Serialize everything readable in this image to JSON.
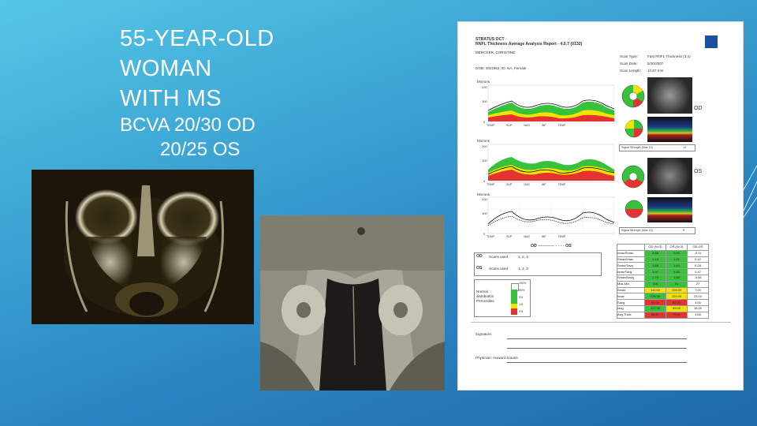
{
  "slide": {
    "title_lines": [
      "55-YEAR-OLD",
      "WOMAN",
      "WITH MS"
    ],
    "bcva_od": "BCVA 20/30 OD",
    "bcva_os": "20/25 OS"
  },
  "report": {
    "header_line1": "STRATUS OCT",
    "header_line2": "RNFL Thickness Average Analysis  Report - 4.0.7 (0132)",
    "patient_name": "MERCKER, CHRISTINE",
    "dob": "DOB: 4/5/1952, ID: NA, Female",
    "scan_type_label": "Scan Type:",
    "scan_type_value": "Fast RNFL Thickness (3.4)",
    "scan_date_label": "Scan Date:",
    "scan_date_value": "5/30/2007",
    "scan_length_label": "Scan Length:",
    "scan_length_value": "10.87 mm",
    "od_label": "OD",
    "os_label": "OS",
    "chart_unit": "Microns",
    "x_ticks": [
      "0",
      "20",
      "40",
      "60",
      "80",
      "100",
      "120",
      "140",
      "160",
      "180",
      "200",
      "220",
      "240",
      "256"
    ],
    "quadrant_ticks": [
      "TEMP",
      "SUP",
      "NAS",
      "INF",
      "TEMP"
    ],
    "y_ticks": [
      "200",
      "100",
      "0"
    ],
    "signal_strength_od": "Signal Strength (Max 10)",
    "signal_strength_od_value": "10",
    "signal_strength_os": "Signal Strength (Max 10)",
    "signal_strength_os_value": "9",
    "legend_od": "OD",
    "legend_os": "OS",
    "scans_used_label": "Scans used",
    "scans_used_od": "1, 2, 3",
    "scans_used_os": "1, 2, 3",
    "normal_distribution": [
      "Normal",
      "distribution",
      "Percentiles"
    ],
    "percentiles": [
      "100%",
      "95%",
      "5%",
      "1%",
      "0%"
    ],
    "table_headers": [
      "OD (N=3)",
      "OS (N=3)",
      "OD-OS"
    ],
    "table_rows": [
      {
        "label": "Imax/Smax",
        "od": "0.88",
        "os": "0.99",
        "diff": "-0.11"
      },
      {
        "label": "Smax/Imax",
        "od": "1.13",
        "os": "1.01",
        "diff": "0.12"
      },
      {
        "label": "Smax/Tavg",
        "od": "1.68",
        "os": "1.40",
        "diff": "0.28"
      },
      {
        "label": "Imax/Tavg",
        "od": "1.97",
        "os": "1.50",
        "diff": "0.47"
      },
      {
        "label": "Smax/Navg",
        "od": "1.76",
        "os": "1.82",
        "diff": "-0.06"
      },
      {
        "label": "Max-Min",
        "od": "118",
        "os": "91",
        "diff": "27"
      },
      {
        "label": "Smax",
        "od": "111.00",
        "os": "104.00",
        "diff": "7.00"
      },
      {
        "label": "Imax",
        "od": "126.00",
        "os": "103.00",
        "diff": "23.00"
      },
      {
        "label": "Savg",
        "od": "91.00",
        "os": "87.00",
        "diff": "4.00"
      },
      {
        "label": "Iavg",
        "od": "107.00",
        "os": "89.00",
        "diff": "18.00"
      },
      {
        "label": "Avg.Thick",
        "od": "84.47",
        "os": "79.81",
        "diff": "4.66"
      }
    ],
    "signature_label": "Signature:",
    "physician": "Physician: Howard Krauss"
  },
  "colors": {
    "bg_top": "#55c7e6",
    "bg_bottom": "#1e6aa9",
    "normal_green": "#35c23a",
    "borderline_yellow": "#f2e200",
    "abnormal_red": "#e53232"
  }
}
